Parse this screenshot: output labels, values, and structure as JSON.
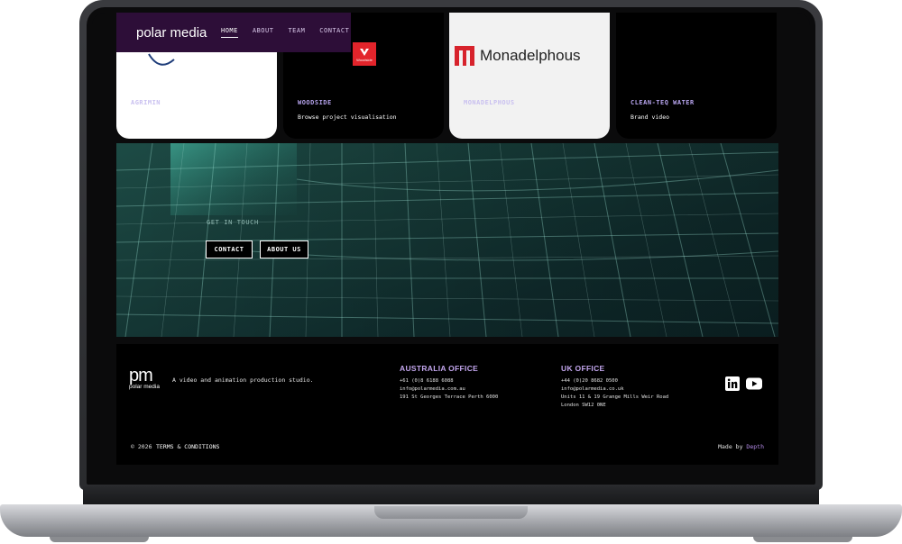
{
  "nav": {
    "brand": "polar media",
    "links": [
      {
        "label": "HOME",
        "active": true
      },
      {
        "label": "ABOUT",
        "active": false
      },
      {
        "label": "TEAM",
        "active": false
      },
      {
        "label": "CONTACT",
        "active": false
      }
    ]
  },
  "cards": [
    {
      "title": "AGRIMIN",
      "subtitle": "",
      "theme": "white"
    },
    {
      "title": "WOODSIDE",
      "subtitle": "Browse project visualisation",
      "theme": "dark",
      "logo_text": "Woodside"
    },
    {
      "title": "MONADELPHOUS",
      "subtitle": "",
      "theme": "grey",
      "logo_text": "Monadelphous"
    },
    {
      "title": "CLEAN-TEQ WATER",
      "subtitle": "Brand video",
      "theme": "dark"
    }
  ],
  "banner": {
    "caption": "GET IN TOUCH",
    "buttons": {
      "contact": "CONTACT",
      "about": "ABOUT US"
    }
  },
  "footer": {
    "logo_mark": "pm",
    "logo_text": "polar media",
    "tagline": "A video and animation production studio.",
    "australia": {
      "title": "AUSTRALIA OFFICE",
      "phone": "+61 (0)8 6188 6088",
      "email": "info@polarmedia.com.au",
      "address": "191 St Georges Terrace Perth 6000"
    },
    "uk": {
      "title": "UK OFFICE",
      "phone": "+44 (0)20 8682 0500",
      "email": "info@polarmedia.co.uk",
      "address1": "Units 11 & 19 Grange Mills Weir Road",
      "address2": "London SW12 0NE"
    },
    "copyright": "© 2026",
    "terms": "TERMS & CONDITIONS",
    "made_by": "Made by",
    "made_by_link": "Depth"
  },
  "colors": {
    "nav_bg": "#2d0e38",
    "accent": "#c3a6ee",
    "woodside_red": "#e3242b",
    "monadelphous_red": "#d7232c"
  }
}
